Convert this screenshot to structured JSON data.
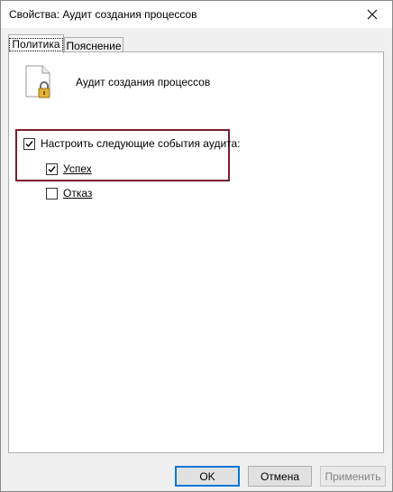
{
  "window": {
    "title": "Свойства: Аудит создания процессов"
  },
  "tabs": [
    {
      "label": "Политика",
      "active": true
    },
    {
      "label": "Пояснение",
      "active": false
    }
  ],
  "policy": {
    "name": "Аудит создания процессов",
    "icon": "document-lock-icon"
  },
  "audit": {
    "configure_label": "Настроить следующие события аудита:",
    "configure_checked": true,
    "success_label": "Успех",
    "success_checked": true,
    "failure_label": "Отказ",
    "failure_checked": false
  },
  "buttons": {
    "ok": "OK",
    "cancel": "Отмена",
    "apply": "Применить"
  },
  "colors": {
    "highlight_border": "#7a1f2b",
    "default_button_border": "#0078d7"
  }
}
